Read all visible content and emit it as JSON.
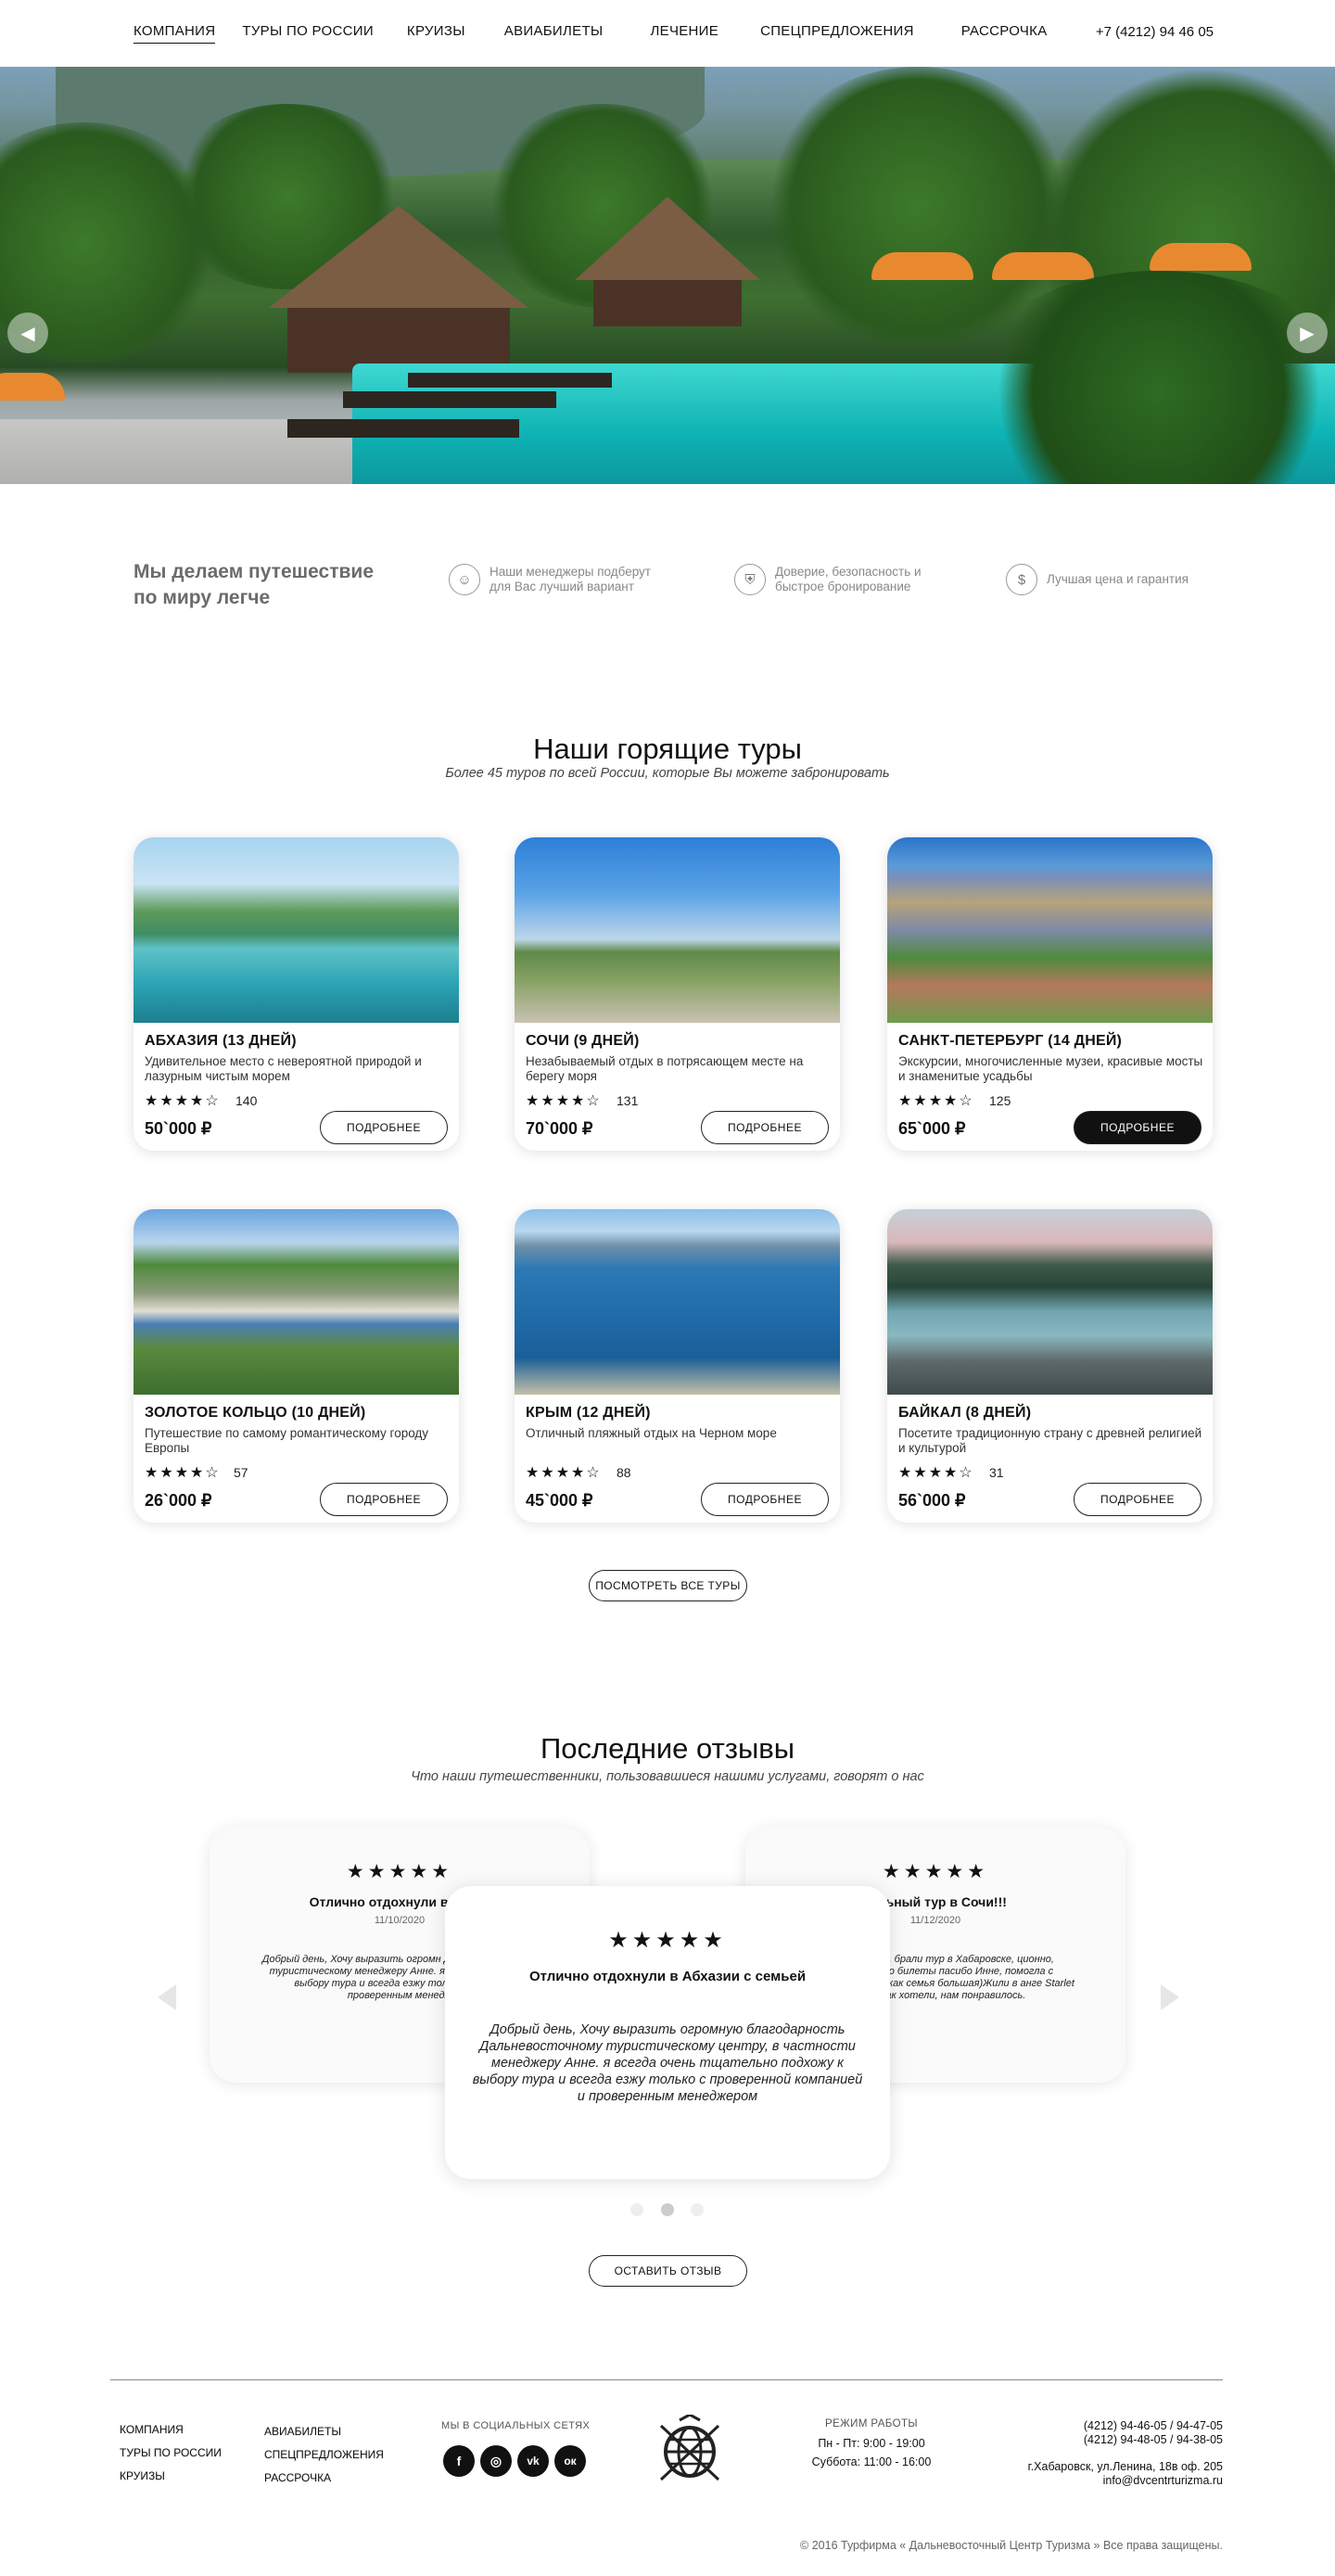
{
  "header": {
    "nav": [
      "КОМПАНИЯ",
      "ТУРЫ ПО РОССИИ",
      "КРУИЗЫ",
      "АВИАБИЛЕТЫ",
      "ЛЕЧЕНИЕ",
      "СПЕЦПРЕДЛОЖЕНИЯ",
      "РАССРОЧКА"
    ],
    "phone": "+7 (4212) 94 46 05"
  },
  "hero": {
    "slides": 2,
    "active_slide": 1
  },
  "features": {
    "slogan": "Мы делаем путешествие по миру легче",
    "items": [
      {
        "icon": "people-icon",
        "text": "Наши менеджеры подберут для Вас лучший вариант"
      },
      {
        "icon": "shield-icon",
        "text": "Доверие, безопасность и быстрое бронирование"
      },
      {
        "icon": "dollar-icon",
        "text": "Лучшая цена и гарантия"
      }
    ]
  },
  "hot_tours": {
    "title": "Наши горящие туры",
    "subtitle": "Более 45 туров по всей России, которые Вы можете забронировать",
    "button_label": "ПОДРОБНЕЕ",
    "cards": [
      {
        "title": "АБХАЗИЯ (13 ДНЕЙ)",
        "desc": "Удивительное место с невероятной природой и лазурным чистым морем",
        "rating": 4,
        "reviews": "140",
        "price": "50`000 ₽"
      },
      {
        "title": "СОЧИ (9 ДНЕЙ)",
        "desc": "Незабываемый отдых в потрясающем месте на берегу моря",
        "rating": 4,
        "reviews": "131",
        "price": "70`000 ₽"
      },
      {
        "title": "САНКТ-ПЕТЕРБУРГ (14 ДНЕЙ)",
        "desc": "Экскурсии, многочисленные музеи, красивые мосты и знаменитые усадьбы",
        "rating": 4,
        "reviews": "125",
        "price": "65`000 ₽"
      },
      {
        "title": "ЗОЛОТОЕ КОЛЬЦО (10 ДНЕЙ)",
        "desc": "Путешествие по самому романтическому городу Европы",
        "rating": 4,
        "reviews": "57",
        "price": "26`000 ₽"
      },
      {
        "title": "КРЫМ (12 ДНЕЙ)",
        "desc": "Отличный пляжный отдых на Черном море",
        "rating": 4,
        "reviews": "88",
        "price": "45`000 ₽"
      },
      {
        "title": "БАЙКАЛ (8 ДНЕЙ)",
        "desc": "Посетите традиционную страну с древней религией и культурой",
        "rating": 4,
        "reviews": "31",
        "price": "56`000 ₽"
      }
    ],
    "all_label": "ПОСМОТРЕТЬ ВСЕ ТУРЫ"
  },
  "reviews": {
    "title": "Последние отзывы",
    "subtitle": "Что наши путешественники, пользовавшиеся нашими услугами, говорят о нас",
    "stars": "★★★★★",
    "left": {
      "title": "Отлично отдохнули в Абхаз",
      "date": "11/10/2020",
      "text": "Добрый день, Хочу выразить огромн Дальневосточному туристическому менеджеру Анне. я всегда очень тщ выбору тура и всегда езжу только с пров и проверенным менедж"
    },
    "center": {
      "title": "Отлично отдохнули в Абхазии с семьей",
      "text": "Добрый день, Хочу выразить огромную благодарность Дальневосточному туристическому центру, в частности менеджеру Анне. я всегда очень тщательно подхожу к выбору тура и всегда езжу только с проверенной компанией и проверенным менеджером"
    },
    "right": {
      "title": "тельный тур в Сочи!!!",
      "date": "11/12/2020",
      "text": "ы иногородние, брали тур в Хабаровске, ционно, забрали только билеты пасибо Инне, помогла с выбором тко, так как семья большая)Жили в анге Starlet 3*. Все как хотели, нам понравилось."
    },
    "leave_label": "ОСТАВИТЬ ОТЗЫВ"
  },
  "footer": {
    "col1": [
      "КОМПАНИЯ",
      "ТУРЫ ПО РОССИИ",
      "КРУИЗЫ"
    ],
    "col2": [
      "АВИАБИЛЕТЫ",
      "СПЕЦПРЕДЛОЖЕНИЯ",
      "РАССРОЧКА"
    ],
    "social_title": "МЫ В СОЦИАЛЬНЫХ СЕТЯХ",
    "social": [
      {
        "icon": "facebook-icon",
        "glyph": "f"
      },
      {
        "icon": "instagram-icon",
        "glyph": "◎"
      },
      {
        "icon": "vk-icon",
        "glyph": "vk"
      },
      {
        "icon": "ok-icon",
        "glyph": "ок"
      }
    ],
    "hours_title": "РЕЖИМ РАБОТЫ",
    "hours1": "Пн - Пт: 9:00 - 19:00",
    "hours2": "Суббота: 11:00 - 16:00",
    "phones1": "(4212) 94-46-05 / 94-47-05",
    "phones2": "(4212) 94-48-05 / 94-38-05",
    "address": "г.Хабаровск, ул.Ленина, 18в оф. 205",
    "email": "info@dvcentrturizma.ru",
    "copyright": "© 2016 Турфирма « Дальневосточный Центр Туризма » Все права защищены."
  }
}
